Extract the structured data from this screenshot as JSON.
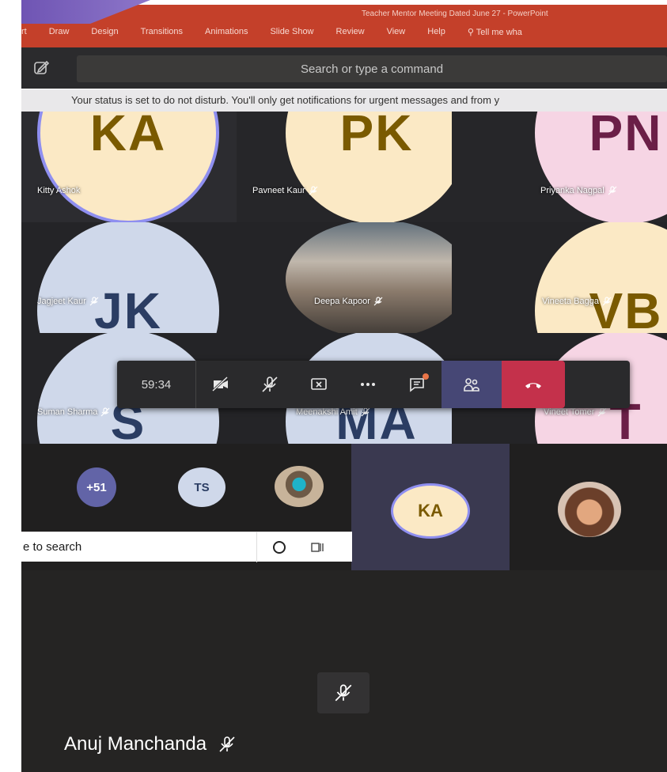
{
  "ppt": {
    "window_title": "Teacher Mentor Meeting Dated June 27  -  PowerPoint",
    "tabs": [
      "rt",
      "Draw",
      "Design",
      "Transitions",
      "Animations",
      "Slide Show",
      "Review",
      "View",
      "Help"
    ],
    "tell_me": "Tell me wha"
  },
  "teams": {
    "search_placeholder": "Search or type a command",
    "dnd_banner": "Your status is set to do not disturb. You'll only get notifications for urgent messages and from y"
  },
  "participants": [
    {
      "initials": "KA",
      "name": "Kitty Ashok",
      "bg": "#fbe9c5",
      "fg": "#7a5a00",
      "muted": false
    },
    {
      "initials": "PK",
      "name": "Pavneet Kaur",
      "bg": "#fbe9c5",
      "fg": "#7a5a00",
      "muted": true
    },
    {
      "initials": "PN",
      "name": "Priyanka Nagpal",
      "bg": "#f6d5e4",
      "fg": "#6b1f47",
      "muted": true
    },
    {
      "initials": "JK",
      "name": "Jagjeet Kaur",
      "bg": "#cfd8ea",
      "fg": "#2b3d63",
      "muted": true
    },
    {
      "initials": "",
      "name": "Deepa Kapoor",
      "bg": "#9a8d7e",
      "fg": "#ffffff",
      "muted": true,
      "photo": true
    },
    {
      "initials": "VB",
      "name": "Vineeta Bagga",
      "bg": "#fbe9c5",
      "fg": "#7a5a00",
      "muted": true
    },
    {
      "initials": "S",
      "name": "Suman Sharma",
      "bg": "#cfd8ea",
      "fg": "#2b3d63",
      "muted": true
    },
    {
      "initials": "MA",
      "name": "Meenakshi Amit",
      "bg": "#cfd8ea",
      "fg": "#2b3d63",
      "muted": true
    },
    {
      "initials": "T",
      "name": "Vineet Tomer",
      "bg": "#f6d5e4",
      "fg": "#6b1f47",
      "muted": true
    }
  ],
  "controls": {
    "timer": "59:34",
    "icons": [
      "camera-off-icon",
      "mic-off-icon",
      "share-screen-icon",
      "more-icon",
      "chat-icon",
      "participants-icon",
      "hang-up-icon"
    ]
  },
  "strip": {
    "overflow_count": "+51",
    "ts_initials": "TS",
    "speaker_initials": "KA"
  },
  "taskbar": {
    "search_text": "e to search"
  },
  "presenter": {
    "name": "Anuj Manchanda"
  }
}
